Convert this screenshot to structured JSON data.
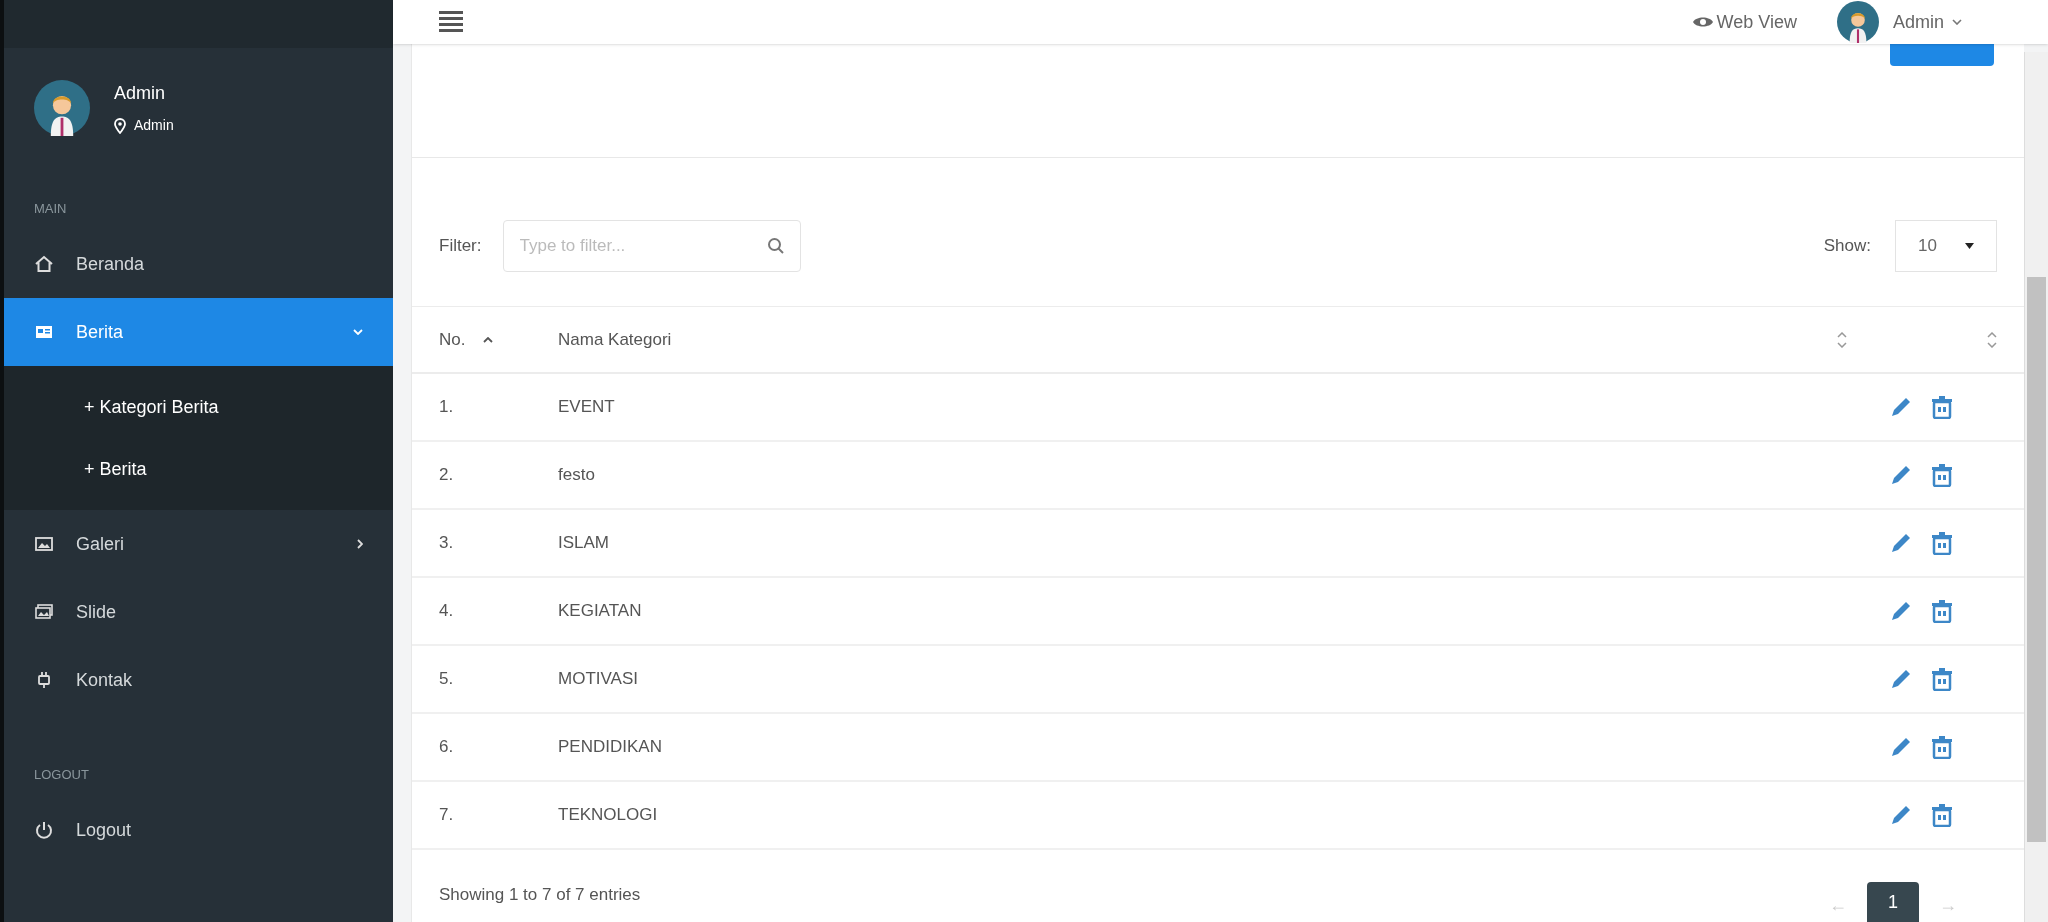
{
  "header": {
    "web_view": "Web View",
    "user": "Admin"
  },
  "sidebar": {
    "profile": {
      "name": "Admin",
      "role": "Admin"
    },
    "sections": [
      {
        "title": "MAIN",
        "items": [
          {
            "label": "Beranda",
            "selected": false
          },
          {
            "label": "Berita",
            "selected": true,
            "expanded": true,
            "children": [
              {
                "label": "+ Kategori Berita"
              },
              {
                "label": "+ Berita"
              }
            ]
          },
          {
            "label": "Galeri",
            "selected": false,
            "expanded": false
          },
          {
            "label": "Slide",
            "selected": false
          },
          {
            "label": "Kontak",
            "selected": false
          }
        ]
      },
      {
        "title": "LOGOUT",
        "items": [
          {
            "label": "Logout",
            "selected": false
          }
        ]
      }
    ]
  },
  "toolbar": {
    "filter_label": "Filter:",
    "filter_placeholder": "Type to filter...",
    "show_label": "Show:",
    "show_value": "10"
  },
  "table": {
    "columns": [
      {
        "label": "No.",
        "sorted": true
      },
      {
        "label": "Nama Kategori",
        "sorted": false
      },
      {
        "sorted": false
      }
    ],
    "rows": [
      {
        "no": "1.",
        "name": "EVENT"
      },
      {
        "no": "2.",
        "name": "festo"
      },
      {
        "no": "3.",
        "name": "ISLAM"
      },
      {
        "no": "4.",
        "name": "KEGIATAN"
      },
      {
        "no": "5.",
        "name": "MOTIVASI"
      },
      {
        "no": "6.",
        "name": "PENDIDIKAN"
      },
      {
        "no": "7.",
        "name": "TEKNOLOGI"
      }
    ]
  },
  "footer": {
    "info": "Showing 1 to 7 of 7 entries",
    "prev": "←",
    "pages": [
      {
        "label": "1",
        "selected": true
      }
    ],
    "next": "→"
  }
}
